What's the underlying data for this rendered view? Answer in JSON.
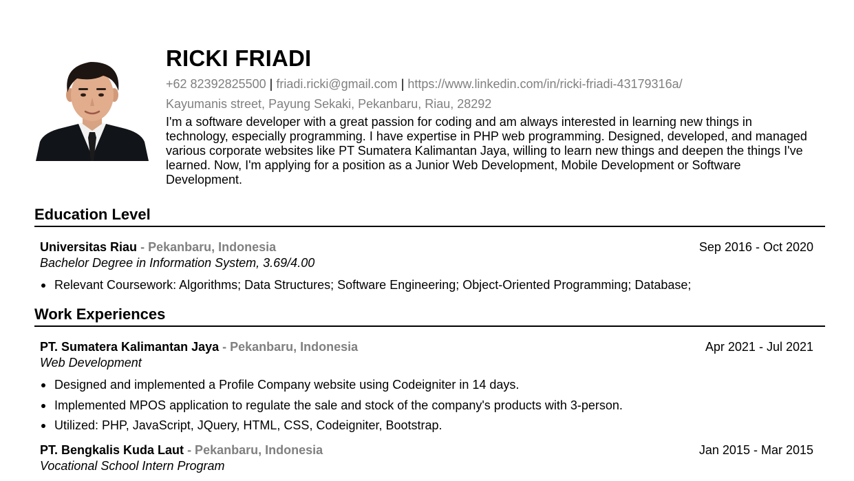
{
  "profile": {
    "name": "RICKI FRIADI",
    "phone": "+62 82392825500",
    "email": "friadi.ricki@gmail.com",
    "linkedin": "https://www.linkedin.com/in/ricki-friadi-43179316a/",
    "separator": "|",
    "address": "Kayumanis street, Payung Sekaki, Pekanbaru, Riau, 28292",
    "summary": "I'm a software developer with a great passion for coding and am always interested in learning new things in technology, especially programming. I have expertise in PHP web programming. Designed, developed, and managed various corporate websites like PT Sumatera Kalimantan Jaya, willing to learn new things and deepen the things I've learned. Now, I'm applying for a position as a Junior Web Development, Mobile Development or Software Development."
  },
  "education": {
    "title": "Education Level",
    "entry": {
      "institution": "Universitas Riau",
      "location": "- Pekanbaru, Indonesia",
      "dates": "Sep 2016 - Oct 2020",
      "degree": "Bachelor Degree in Information System, 3.69/4.00",
      "bullets": [
        "Relevant Coursework: Algorithms; Data Structures; Software Engineering; Object-Oriented Programming; Database;"
      ]
    }
  },
  "work": {
    "title": "Work Experiences",
    "entries": [
      {
        "company": "PT. Sumatera Kalimantan Jaya",
        "location": "-  Pekanbaru, Indonesia",
        "dates": "Apr 2021 - Jul 2021",
        "role": "Web Development",
        "bullets": [
          "Designed and implemented a Profile Company website using Codeigniter in 14 days.",
          "Implemented MPOS application to regulate the sale and stock of the company's products with 3-person.",
          "Utilized: PHP, JavaScript, JQuery, HTML, CSS, Codeigniter, Bootstrap."
        ]
      },
      {
        "company": "PT. Bengkalis Kuda Laut",
        "location": "-  Pekanbaru, Indonesia",
        "dates": "Jan 2015 - Mar 2015",
        "role": "Vocational School Intern Program"
      }
    ]
  }
}
